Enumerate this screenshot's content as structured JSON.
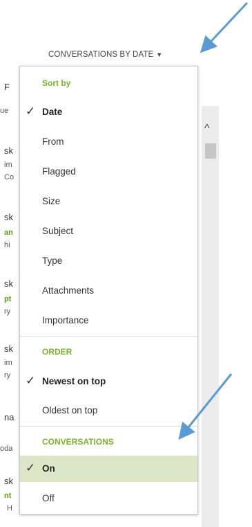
{
  "header": {
    "label": "CONVERSATIONS BY DATE",
    "caret": "▼"
  },
  "background": {
    "fragments": [
      "F",
      "ue",
      "sk",
      "im",
      "Co",
      "sk",
      "an",
      "hi",
      "sk",
      "pt",
      "ry",
      "sk",
      "im",
      "ry",
      "na",
      "oda",
      "sk",
      "nt",
      "H"
    ]
  },
  "menu": {
    "sort_by": {
      "heading": "Sort by",
      "items": [
        "Date",
        "From",
        "Flagged",
        "Size",
        "Subject",
        "Type",
        "Attachments",
        "Importance"
      ],
      "selected": "Date"
    },
    "order": {
      "heading": "ORDER",
      "items": [
        "Newest on top",
        "Oldest on top"
      ],
      "selected": "Newest on top"
    },
    "conversations": {
      "heading": "CONVERSATIONS",
      "items": [
        "On",
        "Off"
      ],
      "selected": "On"
    },
    "check_glyph": "✓"
  },
  "colors": {
    "section_heading": "#7ab522",
    "highlight": "#dbe8c8",
    "annotation_arrow": "#5b9bd5"
  }
}
